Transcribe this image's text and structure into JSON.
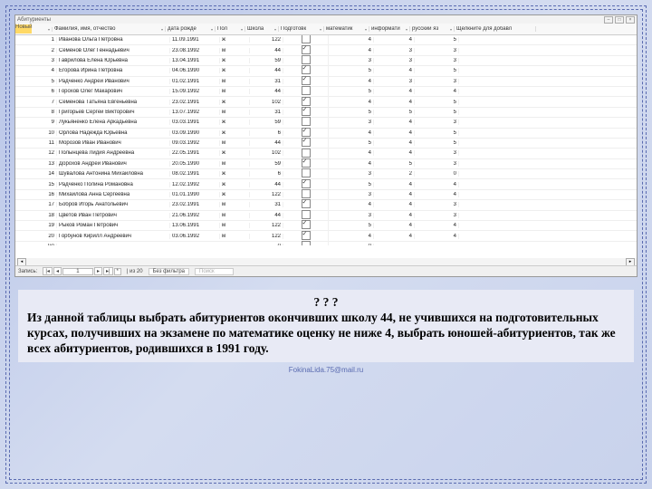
{
  "window": {
    "title": "Абитуриенты",
    "new": "Новый",
    "record": "Запись:",
    "pos": "1",
    "of": "| из 20",
    "filter": "Без фильтра",
    "search": "Поиск"
  },
  "headers": {
    "num": "",
    "fio": "Фамилия, имя, отчество",
    "date": "дата рожде",
    "sex": "Пол",
    "school": "Школа",
    "prep": "Подготовк",
    "mat": "математик",
    "inf": "информати",
    "rus": "русский яз",
    "add": "Щелкните для добавл"
  },
  "rowsum": "(#)",
  "rows": [
    {
      "n": "1",
      "fio": "Иванова Ольга Петровна",
      "d": "11.09.1991",
      "s": "ж",
      "sc": "122",
      "p": false,
      "m": "4",
      "i": "4",
      "r": "5"
    },
    {
      "n": "2",
      "fio": "Семенов Олег Геннадьевич",
      "d": "23.08.1992",
      "s": "м",
      "sc": "44",
      "p": true,
      "m": "4",
      "i": "3",
      "r": "3"
    },
    {
      "n": "3",
      "fio": "Гаврилова Елена Юрьевна",
      "d": "13.04.1991",
      "s": "ж",
      "sc": "59",
      "p": false,
      "m": "3",
      "i": "3",
      "r": "3"
    },
    {
      "n": "4",
      "fio": "Егорова Ирина Петровна",
      "d": "04.06.1990",
      "s": "ж",
      "sc": "44",
      "p": true,
      "m": "5",
      "i": "4",
      "r": "5"
    },
    {
      "n": "5",
      "fio": "Радченко Андрей Иванович",
      "d": "01.02.1991",
      "s": "м",
      "sc": "31",
      "p": true,
      "m": "4",
      "i": "3",
      "r": "3"
    },
    {
      "n": "6",
      "fio": "Горохов Олег Макарович",
      "d": "15.09.1992",
      "s": "м",
      "sc": "44",
      "p": false,
      "m": "5",
      "i": "4",
      "r": "4"
    },
    {
      "n": "7",
      "fio": "Семенова Татьяна Евгеньевна",
      "d": "23.02.1991",
      "s": "ж",
      "sc": "102",
      "p": true,
      "m": "4",
      "i": "4",
      "r": "5"
    },
    {
      "n": "8",
      "fio": "Григорьев Сергей Викторович",
      "d": "13.07.1992",
      "s": "м",
      "sc": "31",
      "p": true,
      "m": "5",
      "i": "5",
      "r": "5"
    },
    {
      "n": "9",
      "fio": "Лукьяненко Елена Аркадьевна",
      "d": "03.03.1991",
      "s": "ж",
      "sc": "59",
      "p": false,
      "m": "3",
      "i": "4",
      "r": "3"
    },
    {
      "n": "10",
      "fio": "Орлова Надежда Юрьевна",
      "d": "03.09.1990",
      "s": "ж",
      "sc": "6",
      "p": true,
      "m": "4",
      "i": "4",
      "r": "5"
    },
    {
      "n": "11",
      "fio": "Морозов Иван Иванович",
      "d": "09.03.1992",
      "s": "м",
      "sc": "44",
      "p": true,
      "m": "5",
      "i": "4",
      "r": "5"
    },
    {
      "n": "12",
      "fio": "Полынцева Лидия Андреевна",
      "d": "22.05.1991",
      "s": "ж",
      "sc": "102",
      "p": false,
      "m": "4",
      "i": "4",
      "r": "3"
    },
    {
      "n": "13",
      "fio": "Дорохов Андрей Иванович",
      "d": "20.05.1990",
      "s": "м",
      "sc": "59",
      "p": true,
      "m": "4",
      "i": "5",
      "r": "3"
    },
    {
      "n": "14",
      "fio": "Шувалова Антонина Михайловна",
      "d": "08.02.1991",
      "s": "ж",
      "sc": "6",
      "p": false,
      "m": "3",
      "i": "2",
      "r": "0"
    },
    {
      "n": "15",
      "fio": "Радченко Полина Романовна",
      "d": "12.02.1992",
      "s": "ж",
      "sc": "44",
      "p": true,
      "m": "5",
      "i": "4",
      "r": "4"
    },
    {
      "n": "16",
      "fio": "Михайлова Анна Сергеевна",
      "d": "01.01.1990",
      "s": "ж",
      "sc": "122",
      "p": false,
      "m": "3",
      "i": "4",
      "r": "4"
    },
    {
      "n": "17",
      "fio": "Бобров Игорь Анатольевич",
      "d": "23.02.1991",
      "s": "м",
      "sc": "31",
      "p": true,
      "m": "4",
      "i": "4",
      "r": "3"
    },
    {
      "n": "18",
      "fio": "Цветов Иван Петрович",
      "d": "21.06.1992",
      "s": "м",
      "sc": "44",
      "p": false,
      "m": "3",
      "i": "4",
      "r": "3"
    },
    {
      "n": "19",
      "fio": "Рыков Роман Петрович",
      "d": "13.06.1991",
      "s": "м",
      "sc": "122",
      "p": true,
      "m": "5",
      "i": "4",
      "r": "4"
    },
    {
      "n": "20",
      "fio": "Горбунов Кирилл Андреевич",
      "d": "03.06.1992",
      "s": "м",
      "sc": "122",
      "p": true,
      "m": "4",
      "i": "4",
      "r": "4"
    }
  ],
  "question": {
    "q": "? ? ?",
    "text": "Из данной таблицы выбрать абитуриентов окончивших школу 44, не учившихся на подготовительных курсах, получивших на экзамене по математике оценку не ниже 4, выбрать юношей-абитуриентов, так же всех абитуриентов, родившихся в 1991 году."
  },
  "footer": "FokinaLida.75@mail.ru"
}
